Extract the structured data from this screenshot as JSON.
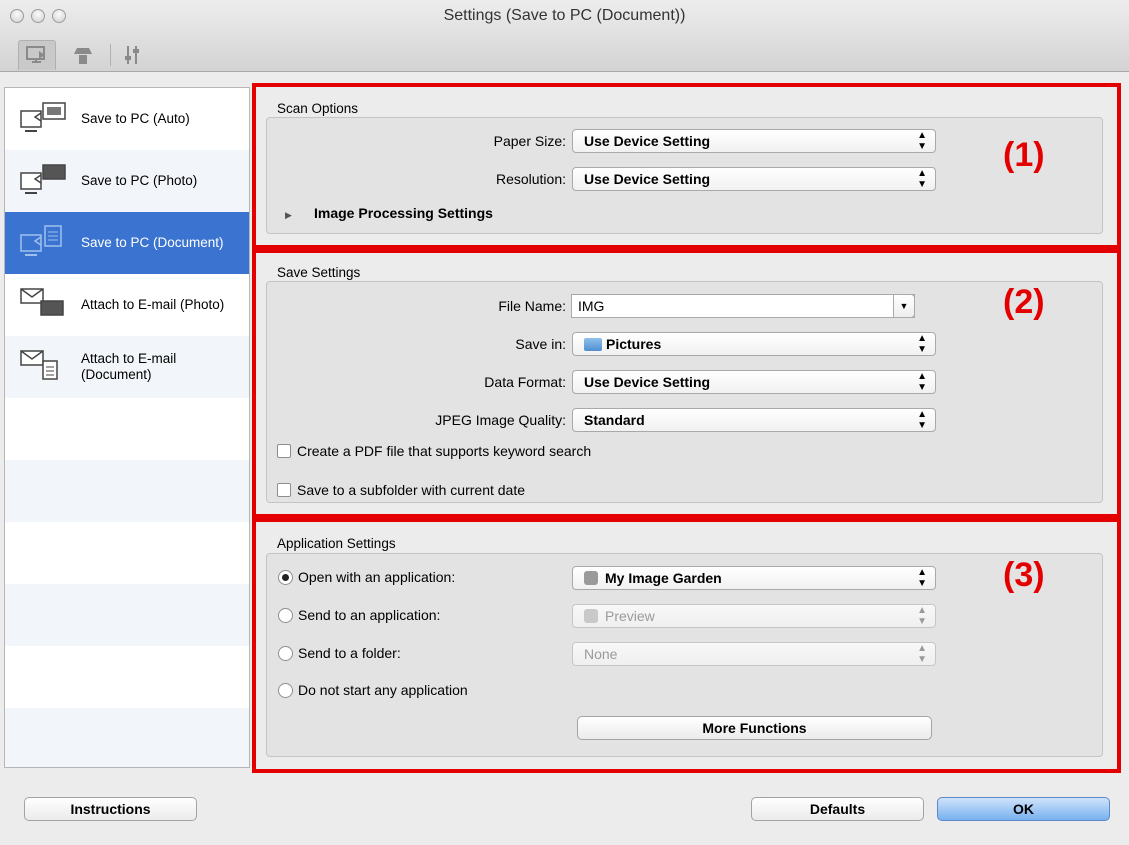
{
  "window": {
    "title": "Settings (Save to PC (Document))",
    "toolbar_icons": [
      "scan-from-computer-icon",
      "scan-from-operation-panel-icon",
      "general-settings-icon"
    ]
  },
  "sidebar": {
    "items": [
      {
        "label": "Save to PC (Auto)",
        "icon": "save-to-pc-auto-icon"
      },
      {
        "label": "Save to PC (Photo)",
        "icon": "save-to-pc-photo-icon"
      },
      {
        "label": "Save to PC (Document)",
        "icon": "save-to-pc-document-icon",
        "selected": true
      },
      {
        "label": "Attach to E-mail (Photo)",
        "icon": "email-photo-icon"
      },
      {
        "label": "Attach to E-mail\n(Document)",
        "icon": "email-document-icon"
      }
    ]
  },
  "callouts": {
    "one": "(1)",
    "two": "(2)",
    "three": "(3)"
  },
  "scan_options": {
    "title": "Scan Options",
    "paper_size_label": "Paper Size:",
    "paper_size_value": "Use Device Setting",
    "resolution_label": "Resolution:",
    "resolution_value": "Use Device Setting",
    "image_processing_label": "Image Processing Settings"
  },
  "save_settings": {
    "title": "Save Settings",
    "file_name_label": "File Name:",
    "file_name_value": "IMG",
    "save_in_label": "Save in:",
    "save_in_value": "Pictures",
    "data_format_label": "Data Format:",
    "data_format_value": "Use Device Setting",
    "jpeg_quality_label": "JPEG Image Quality:",
    "jpeg_quality_value": "Standard",
    "pdf_keyword_label": "Create a PDF file that supports keyword search",
    "subfolder_label": "Save to a subfolder with current date"
  },
  "application_settings": {
    "title": "Application Settings",
    "open_with_label": "Open with an application:",
    "open_with_value": "My Image Garden",
    "send_to_app_label": "Send to an application:",
    "send_to_app_value": "Preview",
    "send_to_folder_label": "Send to a folder:",
    "send_to_folder_value": "None",
    "do_not_start_label": "Do not start any application",
    "more_functions_label": "More Functions"
  },
  "footer": {
    "instructions_label": "Instructions",
    "defaults_label": "Defaults",
    "ok_label": "OK"
  },
  "colors": {
    "highlight_frame": "#e40000",
    "selection": "#3a74d0"
  }
}
